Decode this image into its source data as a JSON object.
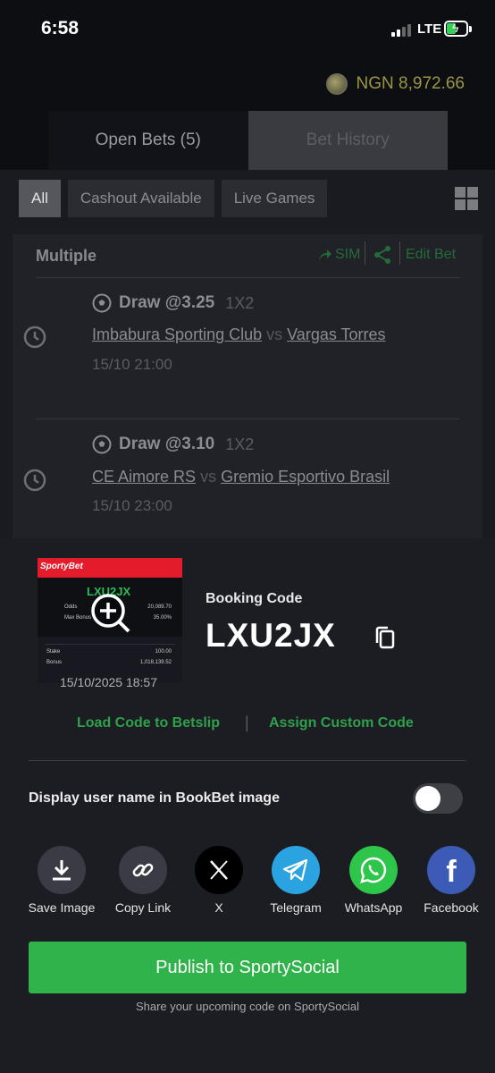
{
  "status_bar": {
    "time": "6:58",
    "network": "LTE"
  },
  "balance": {
    "amount": "NGN 8,972.66"
  },
  "tabs": {
    "open_bets": "Open Bets (5)",
    "bet_history": "Bet History"
  },
  "filters": [
    "All",
    "Cashout Available",
    "Live Games"
  ],
  "bet_card": {
    "title": "Multiple",
    "sim_label": "SIM",
    "edit_label": "Edit Bet",
    "legs": [
      {
        "pick": "Draw @3.25",
        "market": "1X2",
        "home": "Imbabura Sporting Club",
        "vs": "vs",
        "away": "Vargas Torres",
        "time": "15/10 21:00"
      },
      {
        "pick": "Draw @3.10",
        "market": "1X2",
        "home": "CE Aimore RS",
        "vs": "vs",
        "away": "Gremio Esportivo Brasil",
        "time": "15/10 23:00"
      }
    ]
  },
  "sheet": {
    "thumbnail": {
      "brand": "SportyBet",
      "code": "LXU2JX",
      "odds_label": "Odds",
      "odds_value": "20,089.70",
      "bonus_label": "Max Bonus",
      "bonus_value": "35.00%",
      "stake_label": "Stake",
      "stake_value": "100.00",
      "bonus2_label": "Bonus",
      "bonus2_value": "1,018,139.52",
      "date": "15/10/2025 18:57"
    },
    "booking_label": "Booking Code",
    "booking_code": "LXU2JX",
    "load_code": "Load Code to Betslip",
    "separator": "|",
    "assign_code": "Assign Custom Code",
    "toggle_label": "Display user name in BookBet image",
    "toggle_on": false,
    "share_targets": [
      {
        "label": "Save Image",
        "icon": "download-icon",
        "color": "#3a3b44"
      },
      {
        "label": "Copy Link",
        "icon": "link-icon",
        "color": "#3a3b44"
      },
      {
        "label": "X",
        "icon": "x-logo-icon",
        "color": "#000000"
      },
      {
        "label": "Telegram",
        "icon": "telegram-icon",
        "color": "#2aa3e0"
      },
      {
        "label": "WhatsApp",
        "icon": "whatsapp-icon",
        "color": "#2dc54a"
      },
      {
        "label": "Facebook",
        "icon": "facebook-icon",
        "color": "#3b5bb7"
      }
    ],
    "publish_label": "Publish to SportySocial",
    "publish_sub": "Share your upcoming code on SportySocial"
  }
}
